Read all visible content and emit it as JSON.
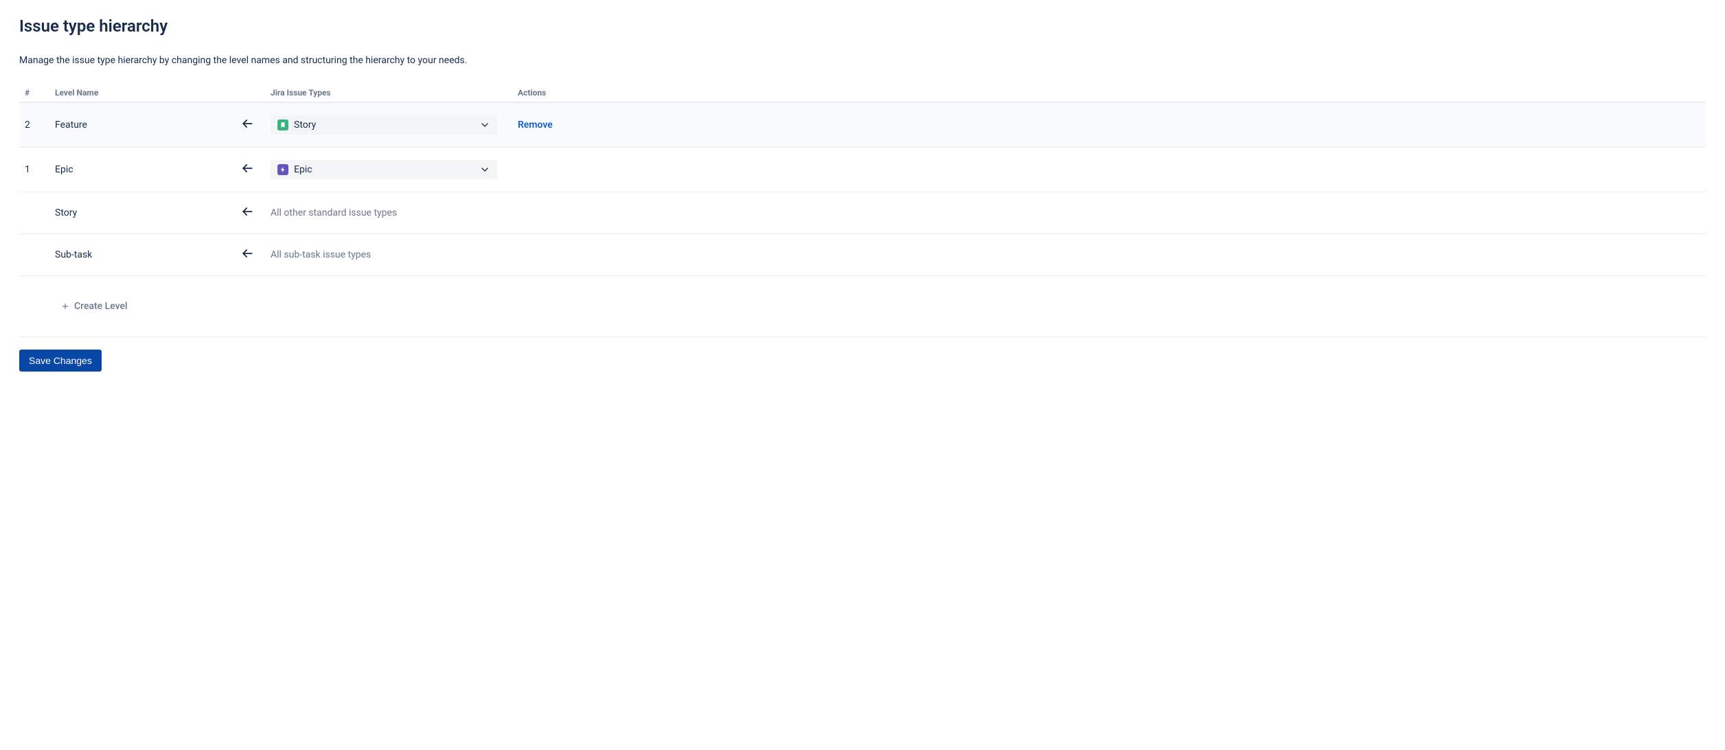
{
  "page": {
    "title": "Issue type hierarchy",
    "description": "Manage the issue type hierarchy by changing the level names and structuring the hierarchy to your needs."
  },
  "table": {
    "headers": {
      "num": "#",
      "name": "Level Name",
      "type": "Jira Issue Types",
      "actions": "Actions"
    },
    "rows": [
      {
        "num": "2",
        "name": "Feature",
        "kind": "select",
        "icon": "story",
        "type_label": "Story",
        "action": "Remove",
        "highlight": true
      },
      {
        "num": "1",
        "name": "Epic",
        "kind": "select",
        "icon": "epic",
        "type_label": "Epic",
        "action": "",
        "highlight": false
      },
      {
        "num": "",
        "name": "Story",
        "kind": "text",
        "type_label": "All other standard issue types",
        "action": "",
        "highlight": false
      },
      {
        "num": "",
        "name": "Sub-task",
        "kind": "text",
        "type_label": "All sub-task issue types",
        "action": "",
        "highlight": false
      }
    ]
  },
  "create_level_label": "Create Level",
  "save_label": "Save Changes"
}
